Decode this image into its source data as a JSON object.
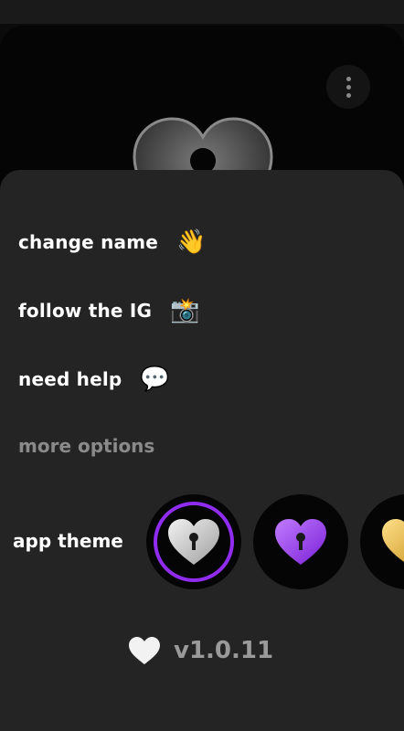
{
  "menu": {
    "change_name": {
      "label": "change name",
      "emoji": "👋"
    },
    "follow_ig": {
      "label": "follow the IG",
      "emoji": "📸"
    },
    "need_help": {
      "label": "need help",
      "emoji": "💬"
    },
    "more_options": "more options"
  },
  "theme": {
    "label": "app theme",
    "options": [
      {
        "name": "silver",
        "color": "#c9c9c9",
        "selected": true
      },
      {
        "name": "purple",
        "color": "#8f2cf0",
        "selected": false
      },
      {
        "name": "gold",
        "color": "#e8b94a",
        "selected": false
      }
    ]
  },
  "footer": {
    "version": "v1.0.11"
  },
  "colors": {
    "accent": "#8f2cf0",
    "sheet_bg": "#242424"
  }
}
